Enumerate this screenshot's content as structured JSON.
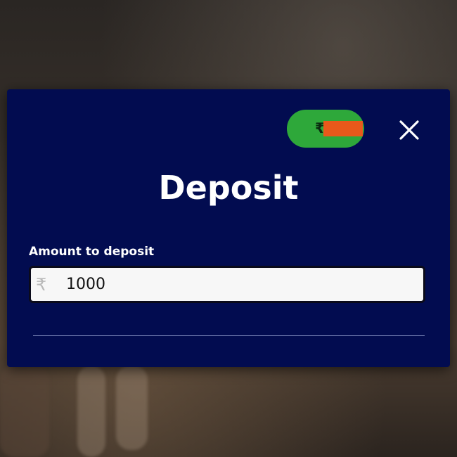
{
  "modal": {
    "title": "Deposit",
    "balance": {
      "currency_symbol": "₹",
      "pill_color": "#2ea83a",
      "redaction_color": "#e8591b"
    },
    "close_icon": "close-icon",
    "background_color": "#020c50"
  },
  "deposit_form": {
    "amount_label": "Amount to deposit",
    "currency_prefix": "₹",
    "amount_value": "1000"
  }
}
